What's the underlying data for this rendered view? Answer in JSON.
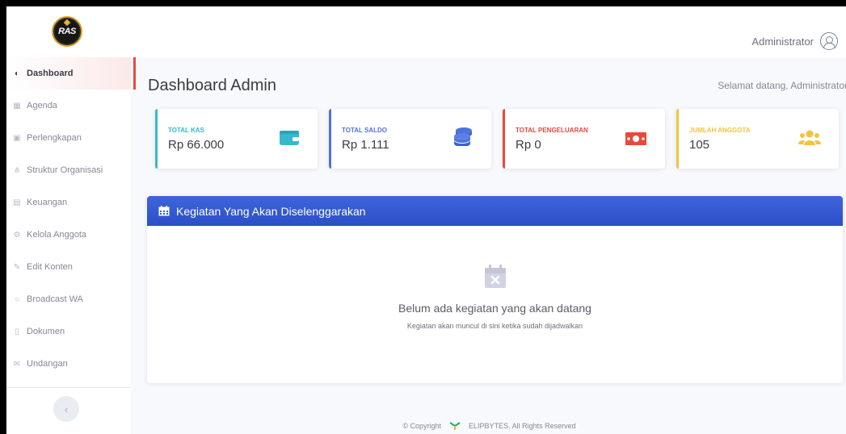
{
  "app": {
    "logo_text": "RAS"
  },
  "topbar": {
    "user_name": "Administrator"
  },
  "sidebar": {
    "items": [
      {
        "label": "Dashboard",
        "icon": "dashboard-icon",
        "active": true
      },
      {
        "label": "Agenda",
        "icon": "calendar-icon",
        "active": false
      },
      {
        "label": "Perlengkapan",
        "icon": "boxes-icon",
        "active": false
      },
      {
        "label": "Struktur Organisasi",
        "icon": "sitemap-icon",
        "active": false
      },
      {
        "label": "Keuangan",
        "icon": "money-icon",
        "active": false
      },
      {
        "label": "Kelola Anggota",
        "icon": "users-cog-icon",
        "active": false
      },
      {
        "label": "Edit Konten",
        "icon": "edit-icon",
        "active": false
      },
      {
        "label": "Broadcast WA",
        "icon": "whatsapp-icon",
        "active": false
      },
      {
        "label": "Dokumen",
        "icon": "file-icon",
        "active": false
      },
      {
        "label": "Undangan",
        "icon": "envelope-icon",
        "active": false
      }
    ],
    "toggle_label": "‹"
  },
  "main": {
    "title": "Dashboard Admin",
    "welcome": "Selamat datang, Administrator",
    "cards": [
      {
        "label": "TOTAL KAS",
        "value": "Rp 66.000",
        "color": "#36b9cc",
        "icon": "wallet-icon"
      },
      {
        "label": "TOTAL SALDO",
        "value": "Rp 1.111",
        "color": "#4e73df",
        "icon": "coins-icon"
      },
      {
        "label": "TOTAL PENGELUARAN",
        "value": "Rp 0",
        "color": "#e74a3b",
        "icon": "money-bill-icon"
      },
      {
        "label": "JUMLAH ANGGOTA",
        "value": "105",
        "color": "#f6c23e",
        "icon": "users-icon"
      }
    ],
    "panel": {
      "title": "Kegiatan Yang Akan Diselenggarakan",
      "empty_title": "Belum ada kegiatan yang akan datang",
      "empty_subtitle": "Kegiatan akan muncul di sini ketika sudah dijadwalkan"
    }
  },
  "footer": {
    "copyright": "© Copyright",
    "brand": "ELIPBYTES. All Rights Reserved"
  }
}
